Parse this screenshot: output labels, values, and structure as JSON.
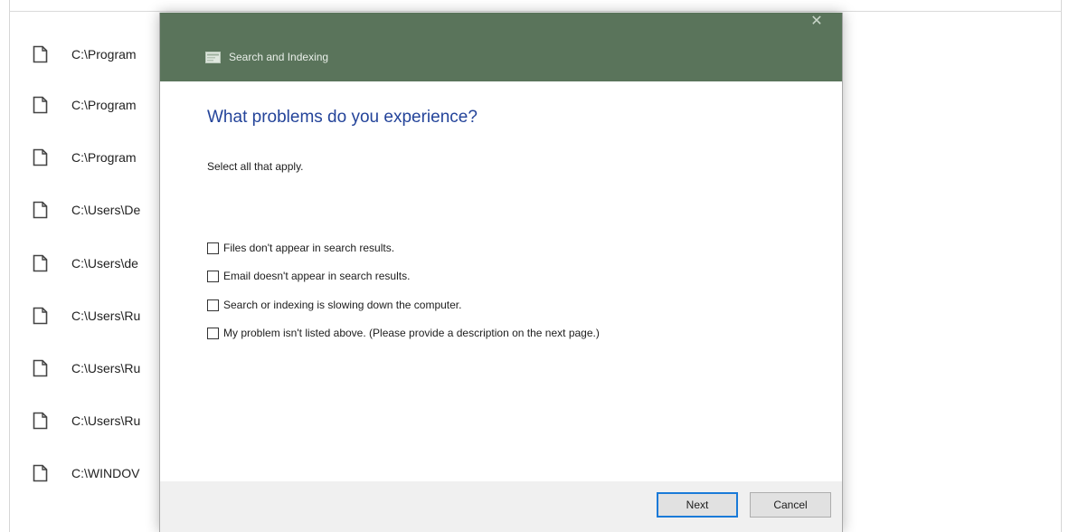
{
  "background_list": {
    "items": [
      {
        "path": "C:\\Program"
      },
      {
        "path": "C:\\Program"
      },
      {
        "path": "C:\\Program"
      },
      {
        "path": "C:\\Users\\De"
      },
      {
        "path": "C:\\Users\\de"
      },
      {
        "path": "C:\\Users\\Ru"
      },
      {
        "path": "C:\\Users\\Ru"
      },
      {
        "path": "C:\\Users\\Ru"
      },
      {
        "path": "C:\\WINDOV"
      }
    ]
  },
  "dialog": {
    "title": "Search and Indexing",
    "close_glyph": "✕",
    "heading": "What problems do you experience?",
    "instruction": "Select all that apply.",
    "options": [
      {
        "label": "Files don't appear in search results.",
        "checked": false
      },
      {
        "label": "Email doesn't appear in search results.",
        "checked": false
      },
      {
        "label": "Search or indexing is slowing down the computer.",
        "checked": false
      },
      {
        "label": "My problem isn't listed above. (Please provide a description on the next page.)",
        "checked": false
      }
    ],
    "buttons": {
      "next": "Next",
      "cancel": "Cancel"
    }
  },
  "colors": {
    "titlebar": "#5a745b",
    "heading": "#24449a",
    "default_button_border": "#1a7ad8"
  },
  "icons": {
    "file": "file-icon",
    "title": "troubleshooter-icon",
    "close": "close-icon"
  }
}
